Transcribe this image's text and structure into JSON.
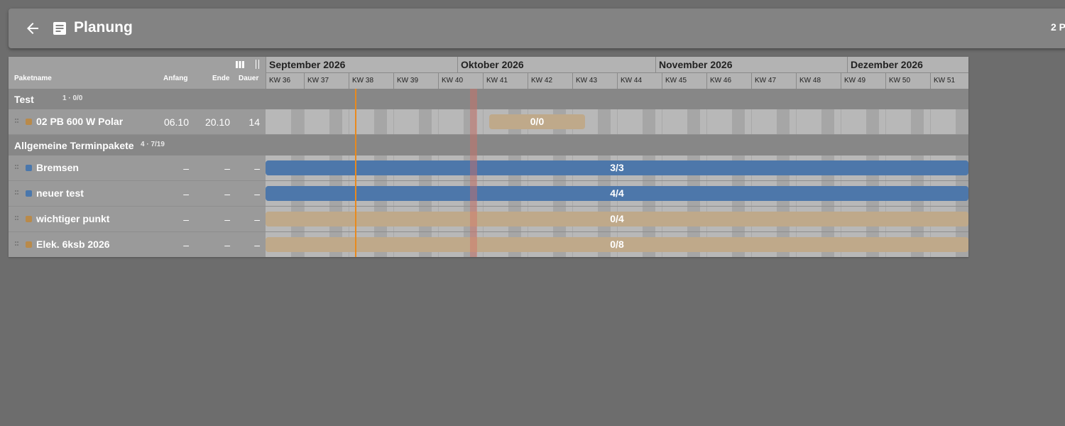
{
  "app": {
    "title": "Planung",
    "right_text": "2 P",
    "back_icon": "arrow-left-icon",
    "page_icon": "document-icon"
  },
  "columns": {
    "name": "Paketname",
    "start": "Anfang",
    "end": "Ende",
    "duration": "Dauer"
  },
  "timeline": {
    "months": [
      {
        "label": "September 2026"
      },
      {
        "label": "Oktober 2026"
      },
      {
        "label": "November 2026"
      },
      {
        "label": "Dezember 2026"
      }
    ],
    "weeks": [
      "KW 36",
      "KW 37",
      "KW 38",
      "KW 39",
      "KW 40",
      "KW 41",
      "KW 42",
      "KW 43",
      "KW 44",
      "KW 45",
      "KW 46",
      "KW 47",
      "KW 48",
      "KW 49",
      "KW 50",
      "KW 51"
    ]
  },
  "groups": [
    {
      "name": "Test",
      "summary": "1 · 0/0",
      "packages": [
        {
          "name": "02 PB 600 W Polar",
          "start": "06.10",
          "end": "20.10",
          "duration": "14",
          "color": "#b98a4a",
          "bar_label": "0/0",
          "bar_type": "placeholder"
        }
      ]
    },
    {
      "name": "Allgemeine Terminpakete",
      "summary": "4 · 7/19",
      "packages": [
        {
          "name": "Bremsen",
          "start": "–",
          "end": "–",
          "duration": "–",
          "color": "#4a77ac",
          "bar_label": "3/3",
          "bar_type": "complete"
        },
        {
          "name": "neuer test",
          "start": "–",
          "end": "–",
          "duration": "–",
          "color": "#4a77ac",
          "bar_label": "4/4",
          "bar_type": "complete"
        },
        {
          "name": "wichtiger punkt",
          "start": "–",
          "end": "–",
          "duration": "–",
          "color": "#b98a4a",
          "bar_label": "0/4",
          "bar_type": "open"
        },
        {
          "name": "Elek. 6ksb 2026",
          "start": "–",
          "end": "–",
          "duration": "–",
          "color": "#b98a4a",
          "bar_label": "0/8",
          "bar_type": "open"
        }
      ]
    }
  ],
  "colors": {
    "complete": "#4d77aa",
    "open": "#bfa98a",
    "today": "#e88a1e"
  }
}
